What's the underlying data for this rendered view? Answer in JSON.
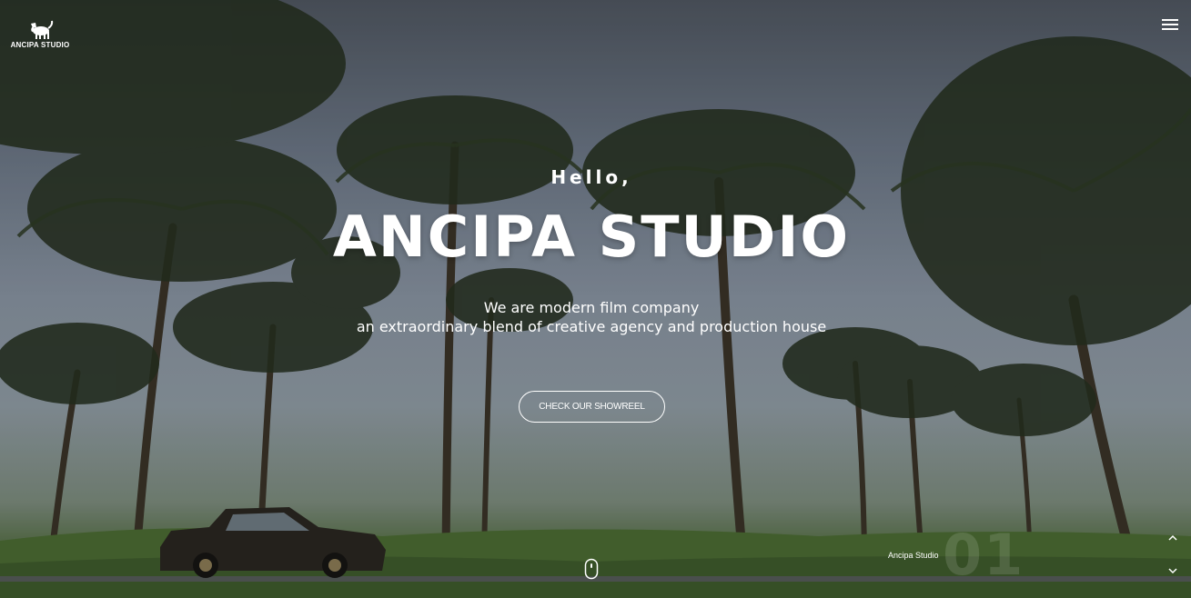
{
  "brand": {
    "logo_text": "ANCIPA STUDIO",
    "logo_icon": "cat-icon"
  },
  "nav": {
    "menu_icon": "hamburger-menu-icon"
  },
  "hero": {
    "greeting": "Hello,",
    "headline": "ANCIPA STUDIO",
    "tagline_line1": "We are modern film company",
    "tagline_line2": "an extraordinary blend of creative agency and production house",
    "cta_label": "CHECK OUR SHOWREEL",
    "scroll_icon": "mouse-scroll-icon"
  },
  "slider": {
    "caption": "Ancipa Studio",
    "number": "01",
    "prev_icon": "chevron-up-icon",
    "next_icon": "chevron-down-icon"
  },
  "colors": {
    "text": "#ffffff",
    "sky_top": "#4f5660",
    "foliage": "#3c5530"
  }
}
